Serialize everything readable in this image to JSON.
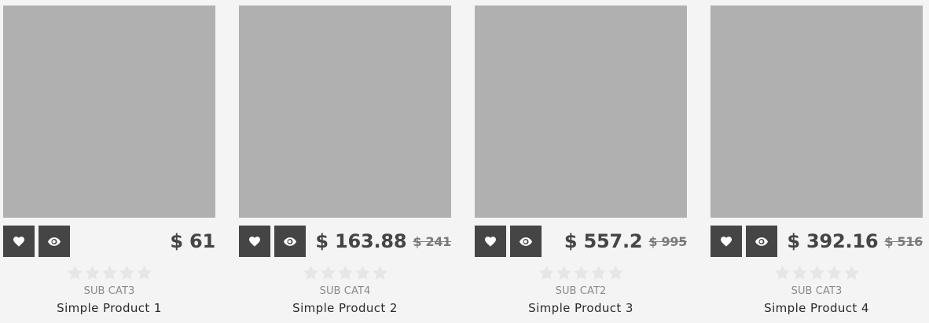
{
  "colors": {
    "background": "#f4f4f4",
    "image_placeholder": "#b0b0b0",
    "action_button": "#454545",
    "price": "#454545",
    "old_price": "#7a7a7a",
    "star_empty": "#e6e6e6"
  },
  "products": [
    {
      "price": "$ 61",
      "old_price": "",
      "category": "SUB CAT3",
      "title": "Simple Product 1",
      "rating_stars": 0,
      "max_stars": 5,
      "icons": [
        "heart-icon",
        "eye-icon"
      ]
    },
    {
      "price": "$ 163.88",
      "old_price": "$ 241",
      "category": "SUB CAT4",
      "title": "Simple Product 2",
      "rating_stars": 0,
      "max_stars": 5,
      "icons": [
        "heart-icon",
        "eye-icon"
      ]
    },
    {
      "price": "$ 557.2",
      "old_price": "$ 995",
      "category": "SUB CAT2",
      "title": "Simple Product 3",
      "rating_stars": 0,
      "max_stars": 5,
      "icons": [
        "heart-icon",
        "eye-icon"
      ]
    },
    {
      "price": "$ 392.16",
      "old_price": "$ 516",
      "category": "SUB CAT3",
      "title": "Simple Product 4",
      "rating_stars": 0,
      "max_stars": 5,
      "icons": [
        "heart-icon",
        "eye-icon"
      ]
    }
  ]
}
